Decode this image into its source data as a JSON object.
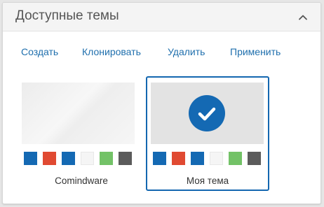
{
  "panel": {
    "title": "Доступные темы",
    "collapse_icon": "chevron-up-icon"
  },
  "toolbar": {
    "create": "Создать",
    "clone": "Клонировать",
    "delete": "Удалить",
    "apply": "Применить"
  },
  "themes": [
    {
      "name": "Comindware",
      "selected": false,
      "swatches": [
        "#1469b3",
        "#e04a32",
        "#1469b3",
        "#f5f5f5",
        "#73c267",
        "#5b5b5b"
      ]
    },
    {
      "name": "Моя тема",
      "selected": true,
      "selected_icon": "check-circle-icon",
      "swatches": [
        "#1469b3",
        "#e04a32",
        "#1469b3",
        "#f5f5f5",
        "#73c267",
        "#5b5b5b"
      ]
    }
  ]
}
